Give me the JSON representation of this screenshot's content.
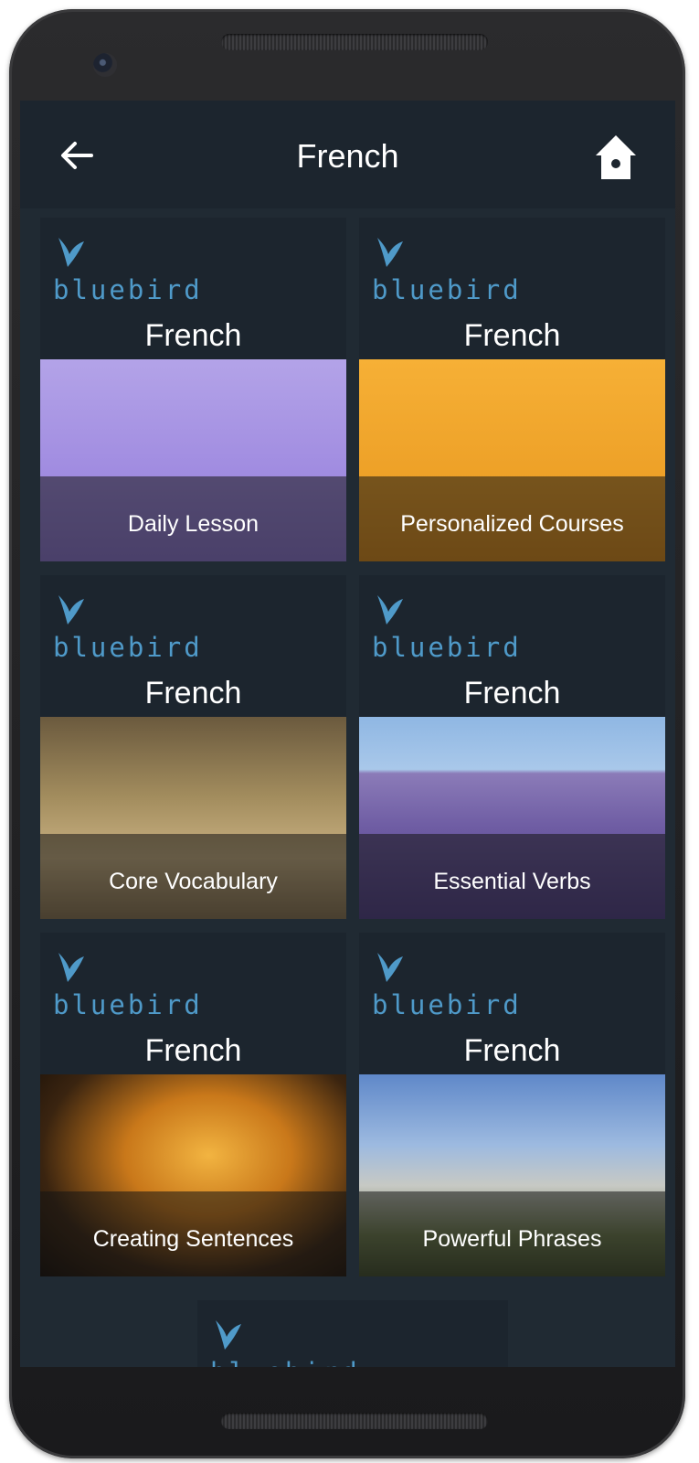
{
  "header": {
    "title": "French"
  },
  "cards": [
    {
      "brand": "bluebird",
      "language": "French",
      "label": "Daily Lesson"
    },
    {
      "brand": "bluebird",
      "language": "French",
      "label": "Personalized Courses"
    },
    {
      "brand": "bluebird",
      "language": "French",
      "label": "Core Vocabulary"
    },
    {
      "brand": "bluebird",
      "language": "French",
      "label": "Essential Verbs"
    },
    {
      "brand": "bluebird",
      "language": "French",
      "label": "Creating Sentences"
    },
    {
      "brand": "bluebird",
      "language": "French",
      "label": "Powerful Phrases"
    }
  ],
  "partial_card": {
    "brand": "bluebird"
  },
  "colors": {
    "background": "#202a33",
    "card": "#1c252e",
    "brand": "#4f9ac9",
    "text": "#ffffff"
  }
}
